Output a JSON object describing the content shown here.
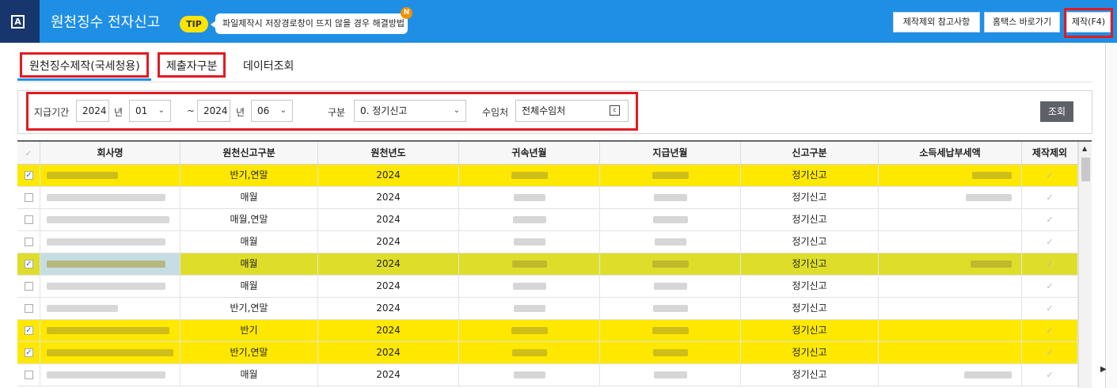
{
  "header": {
    "logo_letter": "A",
    "title": "원천징수 전자신고",
    "tip_label": "TIP",
    "tip_text": "파일제작시 저장경로창이 뜨지 않을 경우 해결방법",
    "new_badge": "N",
    "buttons": [
      "제작제외 참고사항",
      "홈택스 바로가기",
      "제작(F4)"
    ]
  },
  "tabs": [
    "원천징수제작(국세청용)",
    "제출자구분",
    "데이터조회"
  ],
  "filter": {
    "pay_period_label": "지급기간",
    "from_year": "2024",
    "year_unit": "년",
    "from_month": "01",
    "tilde": "~",
    "to_year": "2024",
    "to_month": "06",
    "type_label": "구분",
    "type_value": "0. 정기신고",
    "payee_label": "수임처",
    "payee_value": "전체수임처",
    "search_button": "조회"
  },
  "grid": {
    "columns": [
      "회사명",
      "원천신고구분",
      "원천년도",
      "귀속년월",
      "지급년월",
      "신고구분",
      "소득세납부세액",
      "제작제외"
    ],
    "rows": [
      {
        "checked": true,
        "report_type": "반기,연말",
        "year": "2024",
        "filing": "정기신고",
        "highlight": "yellow"
      },
      {
        "checked": false,
        "report_type": "매월",
        "year": "2024",
        "filing": "정기신고",
        "highlight": "none"
      },
      {
        "checked": false,
        "report_type": "매월,연말",
        "year": "2024",
        "filing": "정기신고",
        "highlight": "none"
      },
      {
        "checked": false,
        "report_type": "매월",
        "year": "2024",
        "filing": "정기신고",
        "highlight": "none"
      },
      {
        "checked": true,
        "report_type": "매월",
        "year": "2024",
        "filing": "정기신고",
        "highlight": "olive"
      },
      {
        "checked": false,
        "report_type": "매월",
        "year": "2024",
        "filing": "정기신고",
        "highlight": "none"
      },
      {
        "checked": false,
        "report_type": "반기,연말",
        "year": "2024",
        "filing": "정기신고",
        "highlight": "none"
      },
      {
        "checked": true,
        "report_type": "반기",
        "year": "2024",
        "filing": "정기신고",
        "highlight": "yellow"
      },
      {
        "checked": true,
        "report_type": "반기,연말",
        "year": "2024",
        "filing": "정기신고",
        "highlight": "yellow"
      },
      {
        "checked": false,
        "report_type": "매월",
        "year": "2024",
        "filing": "정기신고",
        "highlight": "none"
      }
    ]
  },
  "colors": {
    "header_blue": "#1f8fe6",
    "logo_navy": "#17366e",
    "highlight_yellow": "#ffe800",
    "highlight_olive": "#dede2a",
    "callout_red": "#e11b22",
    "tip_yellow": "#ffe400"
  },
  "icons": [
    "app-logo-icon",
    "calendar-icon",
    "chevron-down-icon",
    "checkbox-icon",
    "checkmark-icon",
    "scroll-up-icon",
    "expand-right-icon"
  ]
}
